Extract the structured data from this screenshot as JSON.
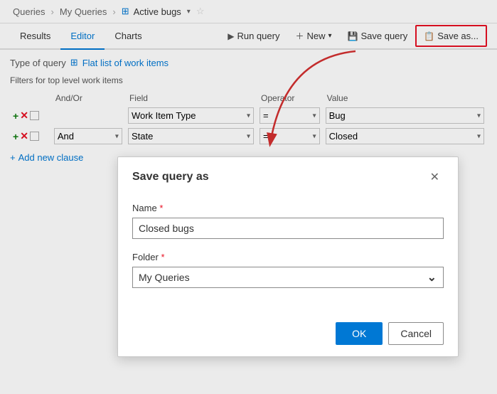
{
  "breadcrumb": {
    "item1": "Queries",
    "item2": "My Queries",
    "active": "Active bugs"
  },
  "tabs": {
    "results": "Results",
    "editor": "Editor",
    "charts": "Charts"
  },
  "toolbar": {
    "run_query": "Run query",
    "new": "New",
    "save_query": "Save query",
    "save_as": "Save as..."
  },
  "query": {
    "type_label": "Type of query",
    "type_value": "Flat list of work items",
    "filters_label": "Filters for top level work items",
    "columns": {
      "andor": "And/Or",
      "field": "Field",
      "operator": "Operator",
      "value": "Value"
    },
    "rows": [
      {
        "andor": "",
        "field": "Work Item Type",
        "operator": "=",
        "value": "Bug"
      },
      {
        "andor": "And",
        "field": "State",
        "operator": "=",
        "value": "Closed"
      }
    ],
    "add_clause": "Add new clause"
  },
  "modal": {
    "title": "Save query as",
    "name_label": "Name",
    "name_value": "Closed bugs",
    "folder_label": "Folder",
    "folder_value": "My Queries",
    "ok": "OK",
    "cancel": "Cancel",
    "required_mark": "*"
  }
}
